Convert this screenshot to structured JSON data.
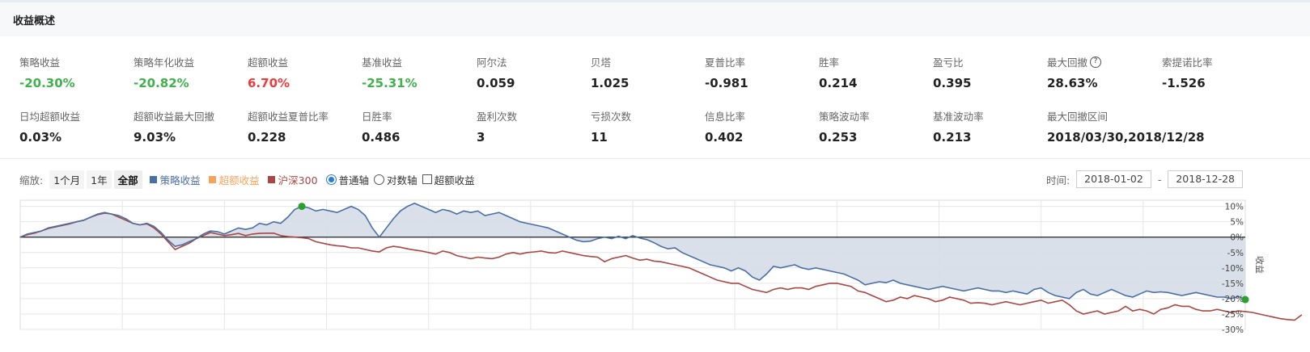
{
  "header": {
    "title": "收益概述"
  },
  "metrics_row1": [
    {
      "label": "策略收益",
      "value": "-20.30%",
      "color": "green"
    },
    {
      "label": "策略年化收益",
      "value": "-20.82%",
      "color": "green"
    },
    {
      "label": "超额收益",
      "value": "6.70%",
      "color": "red"
    },
    {
      "label": "基准收益",
      "value": "-25.31%",
      "color": "green"
    },
    {
      "label": "阿尔法",
      "value": "0.059",
      "color": "normal"
    },
    {
      "label": "贝塔",
      "value": "1.025",
      "color": "normal"
    },
    {
      "label": "夏普比率",
      "value": "-0.981",
      "color": "normal"
    },
    {
      "label": "胜率",
      "value": "0.214",
      "color": "normal"
    },
    {
      "label": "盈亏比",
      "value": "0.395",
      "color": "normal"
    },
    {
      "label": "最大回撤",
      "value": "28.63%",
      "color": "normal",
      "help": "?"
    },
    {
      "label": "索提诺比率",
      "value": "-1.526",
      "color": "normal"
    }
  ],
  "metrics_row2": [
    {
      "label": "日均超额收益",
      "value": "0.03%"
    },
    {
      "label": "超额收益最大回撤",
      "value": "9.03%"
    },
    {
      "label": "超额收益夏普比率",
      "value": "0.228"
    },
    {
      "label": "日胜率",
      "value": "0.486"
    },
    {
      "label": "盈利次数",
      "value": "3"
    },
    {
      "label": "亏损次数",
      "value": "11"
    },
    {
      "label": "信息比率",
      "value": "0.402"
    },
    {
      "label": "策略波动率",
      "value": "0.253"
    },
    {
      "label": "基准波动率",
      "value": "0.213"
    },
    {
      "label": "最大回撤区间",
      "value": "2018/03/30,2018/12/28"
    }
  ],
  "toolbar": {
    "zoom_label": "缩放:",
    "zoom_options": [
      "1个月",
      "1年",
      "全部"
    ],
    "legend": [
      {
        "label": "策略收益",
        "color": "#4a6fa5"
      },
      {
        "label": "超额收益",
        "color": "#f7a35c"
      },
      {
        "label": "沪深300",
        "color": "#aa4643"
      }
    ],
    "axis_normal": "普通轴",
    "axis_log": "对数轴",
    "excess_checkbox": "超额收益",
    "time_label": "时间:",
    "start_date": "2018-01-02",
    "date_sep": "-",
    "end_date": "2018-12-28"
  },
  "colors": {
    "strategy": "#4a6fa5",
    "excess": "#f7a35c",
    "benchmark": "#aa4643",
    "fill": "#d5dde8",
    "marker": "#2ca02c"
  },
  "chart_data": {
    "type": "line",
    "title": "",
    "ylabel": "收益",
    "ylim": [
      -30,
      12
    ],
    "yticks": [
      10,
      5,
      0,
      -5,
      -10,
      -15,
      -20,
      -25,
      -30
    ],
    "ytick_labels": [
      "10%",
      "5%",
      "0%",
      "-5%",
      "-10%",
      "-15%",
      "-20%",
      "-25%",
      "-30%"
    ],
    "x_start": "2018-01-02",
    "x_end": "2018-12-28",
    "series": [
      {
        "name": "策略收益",
        "values": [
          0,
          1,
          1.5,
          2,
          3,
          3.5,
          4,
          4.5,
          5,
          5.5,
          6.5,
          7.5,
          8,
          7.5,
          7,
          6,
          4.5,
          4,
          4.5,
          3.5,
          1.5,
          -1,
          -3,
          -2.5,
          -1.5,
          -0.5,
          1,
          2,
          1.8,
          1,
          2,
          3,
          2.5,
          3,
          4.5,
          4,
          5,
          4.5,
          6.5,
          9,
          10,
          9.5,
          8.5,
          9,
          8.5,
          8,
          9,
          10,
          9,
          7,
          3,
          0,
          3,
          6,
          8.5,
          10,
          11,
          10,
          9,
          8,
          9,
          8.5,
          7.5,
          8.5,
          8,
          8.5,
          7,
          7.5,
          8,
          7,
          6,
          5,
          4.5,
          4,
          3.5,
          3,
          2,
          1,
          0,
          -1,
          -1.5,
          -1.3,
          -0.5,
          0,
          -0.5,
          0.3,
          -0.5,
          0.5,
          -0.3,
          -0.8,
          -1.8,
          -3,
          -3.8,
          -3.5,
          -5,
          -6,
          -7,
          -8,
          -9,
          -9.5,
          -10,
          -11,
          -10,
          -11,
          -13,
          -14,
          -12,
          -9.5,
          -10,
          -9.5,
          -9,
          -10,
          -10.5,
          -10,
          -10.5,
          -11,
          -11.5,
          -12,
          -13,
          -14,
          -15.5,
          -15,
          -14.5,
          -14.8,
          -14,
          -15,
          -15.5,
          -16,
          -16.5,
          -17,
          -16.5,
          -16,
          -16.5,
          -17,
          -17.5,
          -17,
          -16.5,
          -17,
          -17.5,
          -17.5,
          -18,
          -17.5,
          -18,
          -18.5,
          -17,
          -16.5,
          -18,
          -19,
          -19.5,
          -20,
          -18,
          -17,
          -18.5,
          -19,
          -18,
          -17,
          -18,
          -19,
          -19.5,
          -18.5,
          -17.5,
          -18,
          -17.8,
          -18,
          -18.5,
          -19,
          -18.5,
          -18,
          -18.5,
          -19,
          -19.5,
          -19.5,
          -20,
          -19.3,
          -20.3
        ]
      },
      {
        "name": "沪深300",
        "values": [
          0,
          0.8,
          1.3,
          2,
          2.8,
          3.3,
          3.8,
          4.3,
          5,
          5.5,
          6.5,
          7.3,
          7.8,
          7.5,
          6.5,
          5.5,
          4.5,
          4,
          4.3,
          3,
          1,
          -1.5,
          -4,
          -3,
          -2,
          -0.5,
          0.5,
          1.5,
          1,
          0.5,
          0.8,
          1.2,
          0.5,
          1,
          1.2,
          1.3,
          1.3,
          0.5,
          0.2,
          0,
          -0.2,
          -0.5,
          -1.5,
          -2,
          -2.5,
          -2.8,
          -3,
          -3.5,
          -3.5,
          -4,
          -4.5,
          -4.8,
          -3.5,
          -3,
          -3.3,
          -3.8,
          -4.2,
          -4.5,
          -5,
          -5.5,
          -4.5,
          -5,
          -6,
          -6.5,
          -7,
          -6.5,
          -6.8,
          -7,
          -6.5,
          -5.5,
          -5,
          -5.5,
          -5,
          -4.8,
          -4.5,
          -5,
          -5.2,
          -4.5,
          -5,
          -5.5,
          -6,
          -6.3,
          -6.5,
          -8,
          -7,
          -6.5,
          -6,
          -6.8,
          -7.5,
          -7.2,
          -7.8,
          -8,
          -8.5,
          -9,
          -9.5,
          -10,
          -11,
          -12,
          -13,
          -14,
          -14.5,
          -15,
          -15,
          -16,
          -17,
          -17.5,
          -18,
          -17,
          -16.5,
          -17,
          -16.5,
          -16.5,
          -17,
          -16,
          -15.5,
          -15,
          -15,
          -15.5,
          -16,
          -17.5,
          -18,
          -19,
          -20,
          -21,
          -20.5,
          -19.5,
          -20,
          -19,
          -19.5,
          -20,
          -21,
          -20.5,
          -19.5,
          -20,
          -20.5,
          -21.5,
          -21.3,
          -21.5,
          -22,
          -21.5,
          -21,
          -21.5,
          -22,
          -21.5,
          -21,
          -20.5,
          -21.5,
          -21,
          -20.5,
          -22,
          -24,
          -25,
          -24.5,
          -24,
          -25,
          -24.5,
          -24,
          -22.5,
          -24,
          -23.5,
          -24,
          -25,
          -23.5,
          -23,
          -22,
          -22.5,
          -22.5,
          -23.5,
          -24,
          -24,
          -23.5,
          -24,
          -24.5,
          -24,
          -24.2,
          -24.5,
          -25,
          -25.5,
          -26,
          -26.5,
          -26.8,
          -27,
          -25.31
        ]
      }
    ],
    "max_drawdown_markers": [
      {
        "series": "策略收益",
        "index": 40
      },
      {
        "series": "策略收益",
        "index": "last"
      }
    ]
  }
}
